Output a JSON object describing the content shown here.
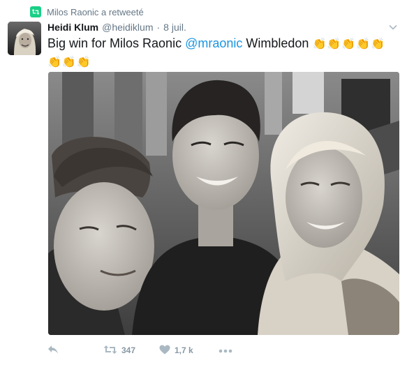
{
  "context": {
    "retweeted_by": "Milos Raonic a retweeté",
    "icon": "retweet-icon"
  },
  "tweet": {
    "author_name": "Heidi Klum",
    "author_handle": "@heidiklum",
    "separator": "·",
    "timestamp": "8 juil.",
    "text_before": "Big win for Milos Raonic",
    "mention": "@mraonic",
    "text_after": "Wimbledon",
    "emoji": "👏👏👏👏👏👏👏👏"
  },
  "actions": {
    "reply_icon": "reply-icon",
    "retweet_icon": "retweet-icon",
    "retweet_count": "347",
    "like_icon": "heart-icon",
    "like_count": "1,7 k",
    "more_icon": "more-icon"
  },
  "colors": {
    "retweet_green": "#19cf86",
    "mention_blue": "#1b95e0",
    "meta_gray": "#657786",
    "action_gray": "#8899a6"
  }
}
